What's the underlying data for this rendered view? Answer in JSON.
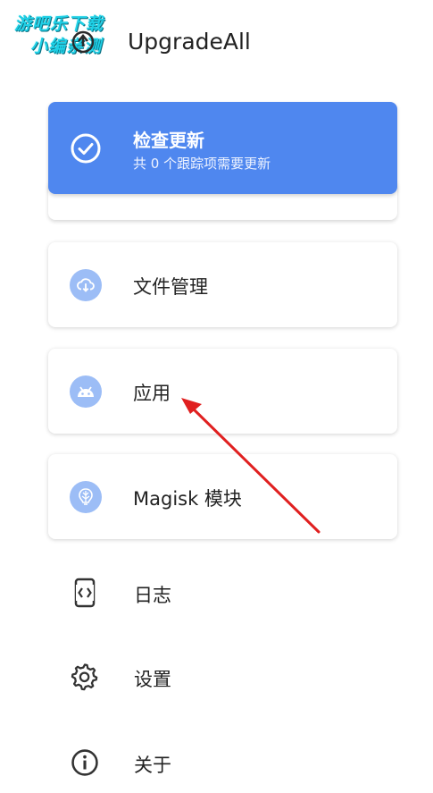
{
  "watermark": {
    "line1": "游吧乐下载",
    "line2": "小编亲测"
  },
  "app": {
    "title": "UpgradeAll"
  },
  "update_card": {
    "title": "检查更新",
    "subtitle": "共 0 个跟踪项需要更新",
    "icon": "check-circle-icon",
    "color": "#4f87ef"
  },
  "cards": [
    {
      "label": "文件管理",
      "icon": "cloud-download-icon"
    },
    {
      "label": "应用",
      "icon": "android-icon"
    },
    {
      "label": "Magisk 模块",
      "icon": "magisk-icon"
    }
  ],
  "menu": [
    {
      "label": "日志",
      "icon": "log-icon"
    },
    {
      "label": "设置",
      "icon": "gear-icon"
    },
    {
      "label": "关于",
      "icon": "info-icon"
    }
  ],
  "annotation": {
    "arrow_color": "#e02020"
  }
}
